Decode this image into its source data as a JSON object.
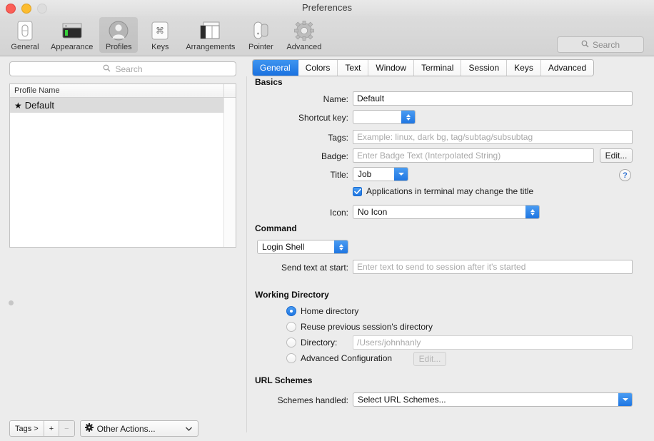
{
  "window": {
    "title": "Preferences",
    "traffic_lights": [
      {
        "name": "close",
        "color": "#fb5f57"
      },
      {
        "name": "minimize",
        "color": "#fcbc2e"
      },
      {
        "name": "zoom",
        "color": "#dddddd"
      }
    ]
  },
  "toolbar": {
    "items": [
      {
        "label": "General",
        "icon": "general-toggle-icon",
        "selected": false
      },
      {
        "label": "Appearance",
        "icon": "terminal-window-icon",
        "selected": false
      },
      {
        "label": "Profiles",
        "icon": "person-silhouette-icon",
        "selected": true
      },
      {
        "label": "Keys",
        "icon": "command-key-icon",
        "selected": false
      },
      {
        "label": "Arrangements",
        "icon": "window-panes-icon",
        "selected": false
      },
      {
        "label": "Pointer",
        "icon": "mouse-icon",
        "selected": false
      },
      {
        "label": "Advanced",
        "icon": "gear-icon",
        "selected": false
      }
    ],
    "search": {
      "placeholder": "Search",
      "value": "",
      "icon": "search-icon"
    }
  },
  "sidebar": {
    "search": {
      "placeholder": "Search",
      "value": "",
      "icon": "search-icon"
    },
    "list": {
      "column_header": "Profile Name",
      "rows": [
        {
          "name": "Default",
          "is_default": true,
          "star": "★",
          "selected": true
        }
      ]
    },
    "footer": {
      "tags_label": "Tags >",
      "add_label": "+",
      "remove_label": "−",
      "other_actions_label": "Other Actions...",
      "other_actions_icon": "gear-icon",
      "chevron": "⌄"
    }
  },
  "main": {
    "tabs": [
      {
        "label": "General",
        "active": true
      },
      {
        "label": "Colors",
        "active": false
      },
      {
        "label": "Text",
        "active": false
      },
      {
        "label": "Window",
        "active": false
      },
      {
        "label": "Terminal",
        "active": false
      },
      {
        "label": "Session",
        "active": false
      },
      {
        "label": "Keys",
        "active": false
      },
      {
        "label": "Advanced",
        "active": false
      }
    ],
    "basics": {
      "title": "Basics",
      "name": {
        "label": "Name:",
        "value": "Default"
      },
      "shortcut_key": {
        "label": "Shortcut key:",
        "value": ""
      },
      "tags": {
        "label": "Tags:",
        "value": "",
        "placeholder": "Example: linux, dark bg, tag/subtag/subsubtag"
      },
      "badge": {
        "label": "Badge:",
        "value": "",
        "placeholder": "Enter Badge Text (Interpolated String)",
        "edit_label": "Edit..."
      },
      "title_field": {
        "label": "Title:",
        "value": "Job"
      },
      "help_label": "?",
      "apps_change_title": {
        "label": "Applications in terminal may change the title",
        "checked": true
      },
      "icon": {
        "label": "Icon:",
        "value": "No Icon"
      }
    },
    "command": {
      "title": "Command",
      "shell": {
        "value": "Login Shell"
      },
      "send_text": {
        "label": "Send text at start:",
        "value": "",
        "placeholder": "Enter text to send to session after it's started"
      }
    },
    "working_directory": {
      "title": "Working Directory",
      "options": [
        {
          "label": "Home directory",
          "selected": true
        },
        {
          "label": "Reuse previous session's directory",
          "selected": false
        },
        {
          "label": "Directory:",
          "selected": false
        },
        {
          "label": "Advanced Configuration",
          "selected": false
        }
      ],
      "directory_field": {
        "value": "",
        "placeholder": "/Users/johnhanly"
      },
      "advanced_edit_label": "Edit..."
    },
    "url_schemes": {
      "title": "URL Schemes",
      "schemes_handled": {
        "label": "Schemes handled:",
        "value": "Select URL Schemes..."
      }
    }
  }
}
